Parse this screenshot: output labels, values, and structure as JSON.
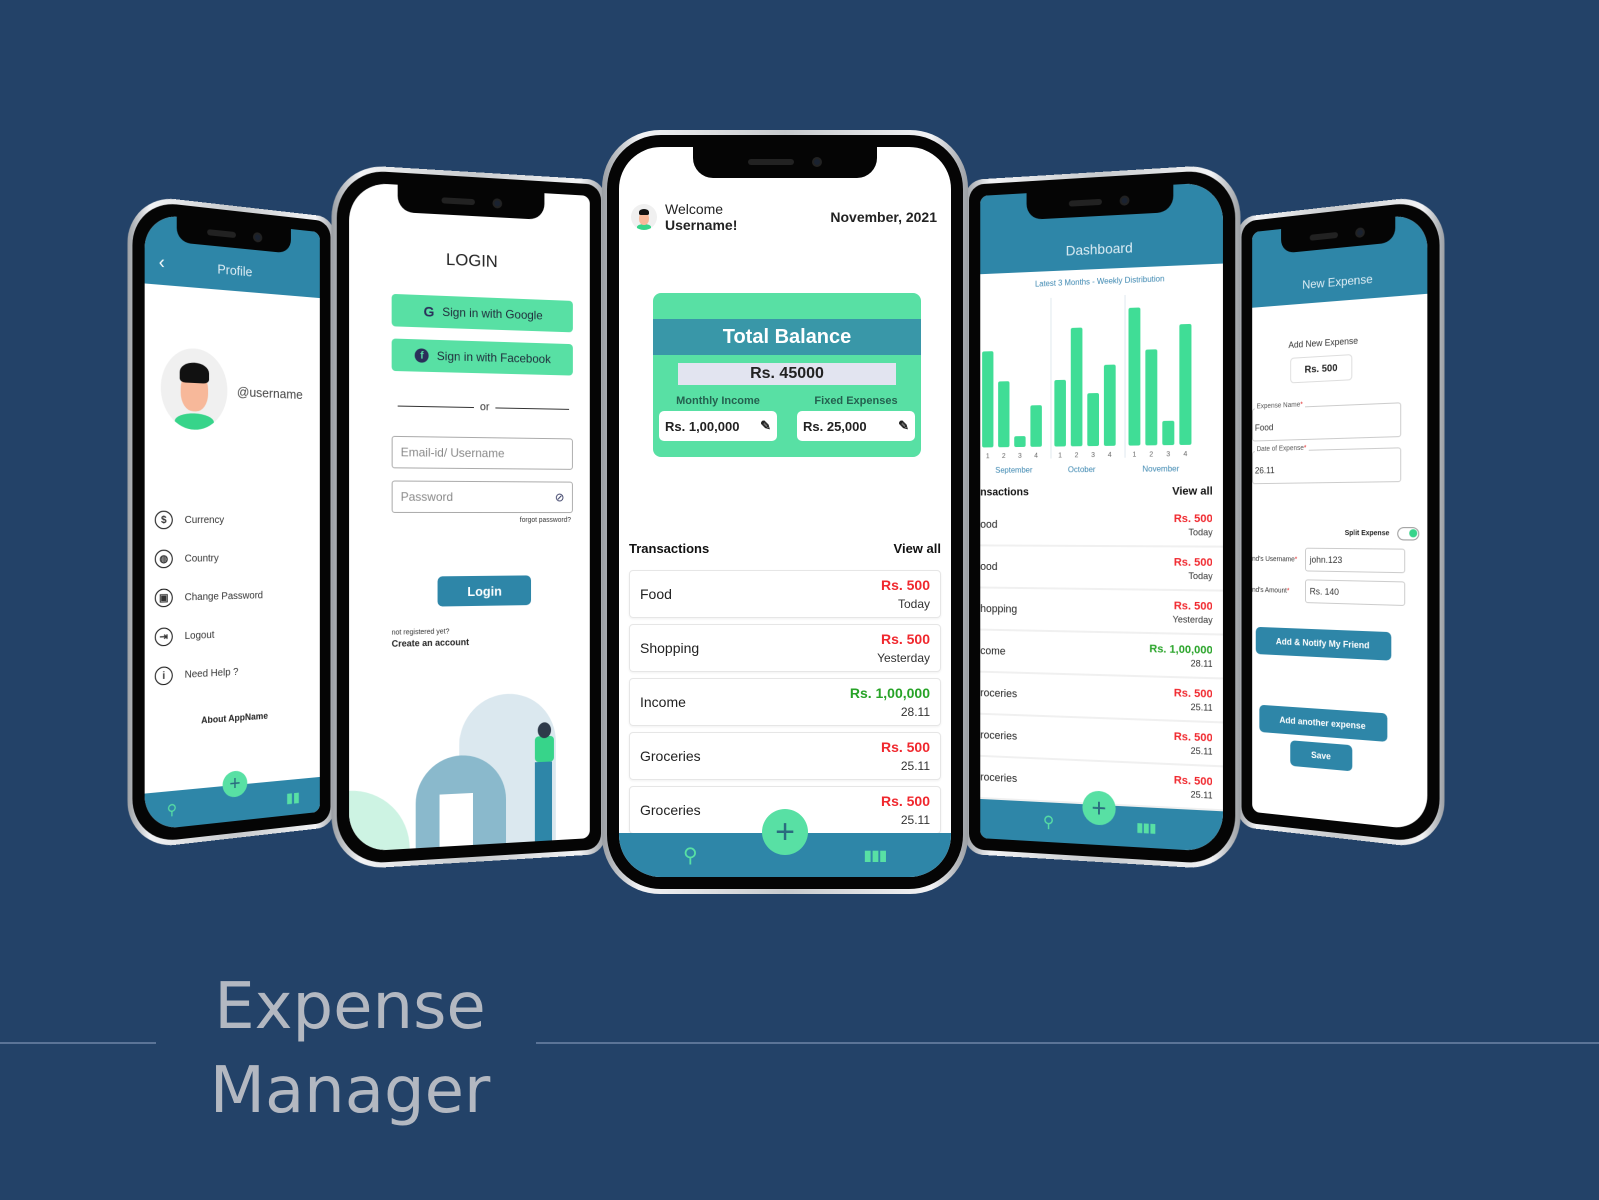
{
  "title": {
    "line1": "Expense",
    "line2": "Manager"
  },
  "colors": {
    "background": "#234268",
    "primary": "#2e86a8",
    "accent": "#58e0a4",
    "expense": "#f0282e",
    "income": "#27a327"
  },
  "profile": {
    "header": "Profile",
    "username": "@username",
    "menu": [
      {
        "icon": "currency-icon",
        "glyph": "$",
        "label": "Currency"
      },
      {
        "icon": "globe-icon",
        "glyph": "◍",
        "label": "Country"
      },
      {
        "icon": "lock-icon",
        "glyph": "▣",
        "label": "Change Password"
      },
      {
        "icon": "logout-icon",
        "glyph": "⇥",
        "label": "Logout"
      },
      {
        "icon": "info-icon",
        "glyph": "i",
        "label": "Need Help ?"
      }
    ],
    "about": "About AppName"
  },
  "login": {
    "title": "LOGIN",
    "google": "Sign in with Google",
    "facebook": "Sign in with Facebook",
    "or": "or",
    "email_placeholder": "Email-id/ Username",
    "password_placeholder": "Password",
    "forgot": "forgot password?",
    "login_button": "Login",
    "not_registered": "not registered yet?",
    "create_account": "Create an account"
  },
  "home": {
    "welcome": "Welcome",
    "username": "Username!",
    "date": "November, 2021",
    "balance_title": "Total Balance",
    "balance_value": "Rs. 45000",
    "monthly_income_label": "Monthly Income",
    "monthly_income_value": "Rs. 1,00,000",
    "fixed_expenses_label": "Fixed Expenses",
    "fixed_expenses_value": "Rs. 25,000",
    "transactions_label": "Transactions",
    "view_all": "View all",
    "transactions": [
      {
        "name": "Food",
        "amount": "Rs. 500",
        "date": "Today",
        "type": "expense"
      },
      {
        "name": "Shopping",
        "amount": "Rs. 500",
        "date": "Yesterday",
        "type": "expense"
      },
      {
        "name": "Income",
        "amount": "Rs. 1,00,000",
        "date": "28.11",
        "type": "income"
      },
      {
        "name": "Groceries",
        "amount": "Rs. 500",
        "date": "25.11",
        "type": "expense"
      },
      {
        "name": "Groceries",
        "amount": "Rs. 500",
        "date": "25.11",
        "type": "expense"
      }
    ]
  },
  "dashboard": {
    "header": "Dashboard",
    "transactions_label": "nsactions",
    "view_all": "View all",
    "transactions": [
      {
        "name": "ood",
        "amount": "Rs. 500",
        "date": "Today",
        "type": "expense"
      },
      {
        "name": "ood",
        "amount": "Rs. 500",
        "date": "Today",
        "type": "expense"
      },
      {
        "name": "hopping",
        "amount": "Rs. 500",
        "date": "Yesterday",
        "type": "expense"
      },
      {
        "name": "come",
        "amount": "Rs. 1,00,000",
        "date": "28.11",
        "type": "income"
      },
      {
        "name": "roceries",
        "amount": "Rs. 500",
        "date": "25.11",
        "type": "expense"
      },
      {
        "name": "roceries",
        "amount": "Rs. 500",
        "date": "25.11",
        "type": "expense"
      },
      {
        "name": "roceries",
        "amount": "Rs. 500",
        "date": "25.11",
        "type": "expense"
      }
    ]
  },
  "chart_data": {
    "type": "bar",
    "title": "Latest 3 Months - Weekly Distribution",
    "xlabel": "",
    "ylabel": "",
    "grid": false,
    "ylim": [
      0,
      100
    ],
    "categories": [
      "1",
      "2",
      "3",
      "4",
      "1",
      "2",
      "3",
      "4",
      "1",
      "2",
      "3",
      "4"
    ],
    "groups": [
      {
        "name": "September",
        "weeks": [
          "1",
          "2",
          "3",
          "4"
        ],
        "values": [
          70,
          48,
          8,
          30
        ]
      },
      {
        "name": "October",
        "weeks": [
          "1",
          "2",
          "3",
          "4"
        ],
        "values": [
          48,
          85,
          38,
          58
        ]
      },
      {
        "name": "November",
        "weeks": [
          "1",
          "2",
          "3",
          "4"
        ],
        "values": [
          98,
          68,
          17,
          85
        ]
      }
    ]
  },
  "new_expense": {
    "header": "New Expense",
    "add_label": "Add New Expense",
    "amount": "Rs. 500",
    "expense_name_label": "Expense Name",
    "expense_name_value": "Food",
    "date_label": "Date of Expense",
    "date_value": "26.11",
    "split_label": "Split Expense",
    "split_on": true,
    "friend_username_label": "nd's Username",
    "friend_username_value": "john.123",
    "friend_amount_label": "nd's Amount",
    "friend_amount_value": "Rs. 140",
    "notify_button": "Add & Notify My Friend",
    "add_another_button": "Add another expense",
    "save_button": "Save"
  }
}
